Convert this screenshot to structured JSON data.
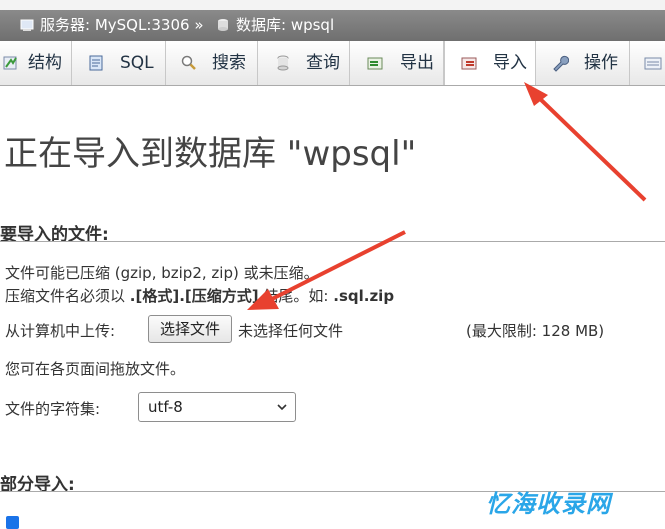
{
  "breadcrumb": {
    "server_label": "服务器: MySQL:3306 »",
    "db_label": "数据库: wpsql"
  },
  "tabs": [
    {
      "label": "结构",
      "icon": "structure-icon"
    },
    {
      "label": "SQL",
      "icon": "sql-icon"
    },
    {
      "label": "搜索",
      "icon": "search-icon"
    },
    {
      "label": "查询",
      "icon": "query-icon"
    },
    {
      "label": "导出",
      "icon": "export-icon"
    },
    {
      "label": "导入",
      "icon": "import-icon",
      "active": true
    },
    {
      "label": "操作",
      "icon": "wrench-icon"
    }
  ],
  "page_title": "正在导入到数据库 \"wpsql\"",
  "file_section": {
    "heading": "要导入的文件:",
    "compress_line": "文件可能已压缩 (gzip, bzip2, zip) 或未压缩。",
    "name_line_prefix": "压缩文件名必须以",
    "name_line_format": ".[格式].[压缩方式]",
    "name_line_mid": "结尾。如:",
    "name_line_example": ".sql.zip",
    "upload_label": "从计算机中上传:",
    "choose_button": "选择文件",
    "no_file": "未选择任何文件",
    "max_limit": "(最大限制: 128 MB)",
    "drag_hint": "您可在各页面间拖放文件。",
    "charset_label": "文件的字符集:",
    "charset_value": "utf-8"
  },
  "partial_section": {
    "heading": "部分导入:"
  },
  "watermark": "忆海收录网",
  "colors": {
    "arrow": "#e8412f",
    "breadcrumb_bg": "#7a7a7a",
    "watermark": "#2aa6e8"
  }
}
